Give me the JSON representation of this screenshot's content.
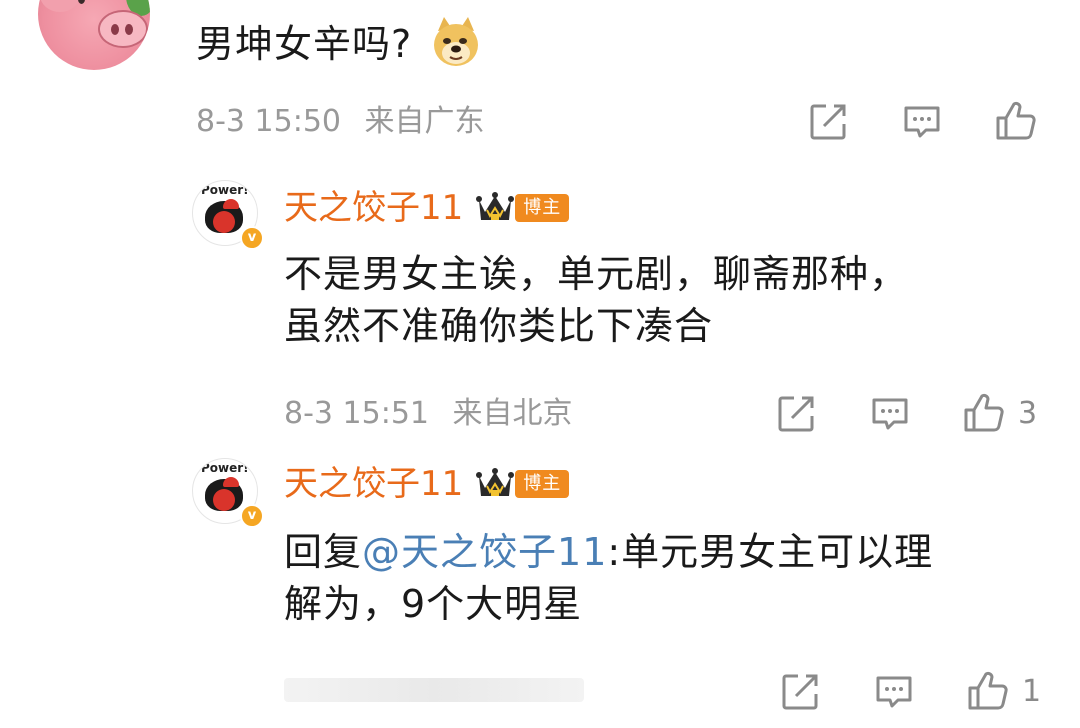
{
  "top_comment": {
    "text": "男坤女辛吗?",
    "emoji": "doge-emoji",
    "time": "8-3 15:50",
    "location": "来自广东"
  },
  "replies": [
    {
      "username": "天之饺子11",
      "tag": "博主",
      "avatar_text": "Power!",
      "lines": [
        "不是男女主诶，单元剧，聊斋那种，",
        "虽然不准确你类比下凑合"
      ],
      "time": "8-3 15:51",
      "location": "来自北京",
      "like_count": "3"
    },
    {
      "username": "天之饺子11",
      "tag": "博主",
      "avatar_text": "Power!",
      "reply_prefix": "回复",
      "mention": "@天之饺子11",
      "reply_rest": ":单元男女主可以理",
      "line2": "解为，9个大明星",
      "like_count": "1"
    }
  ],
  "colors": {
    "username": "#e86a1a",
    "tag_bg": "#f08a1f",
    "mention": "#4a7fb5",
    "meta": "#999999"
  },
  "icons": [
    "share-icon",
    "comment-icon",
    "like-icon",
    "crown-icon",
    "verified-badge-icon"
  ]
}
